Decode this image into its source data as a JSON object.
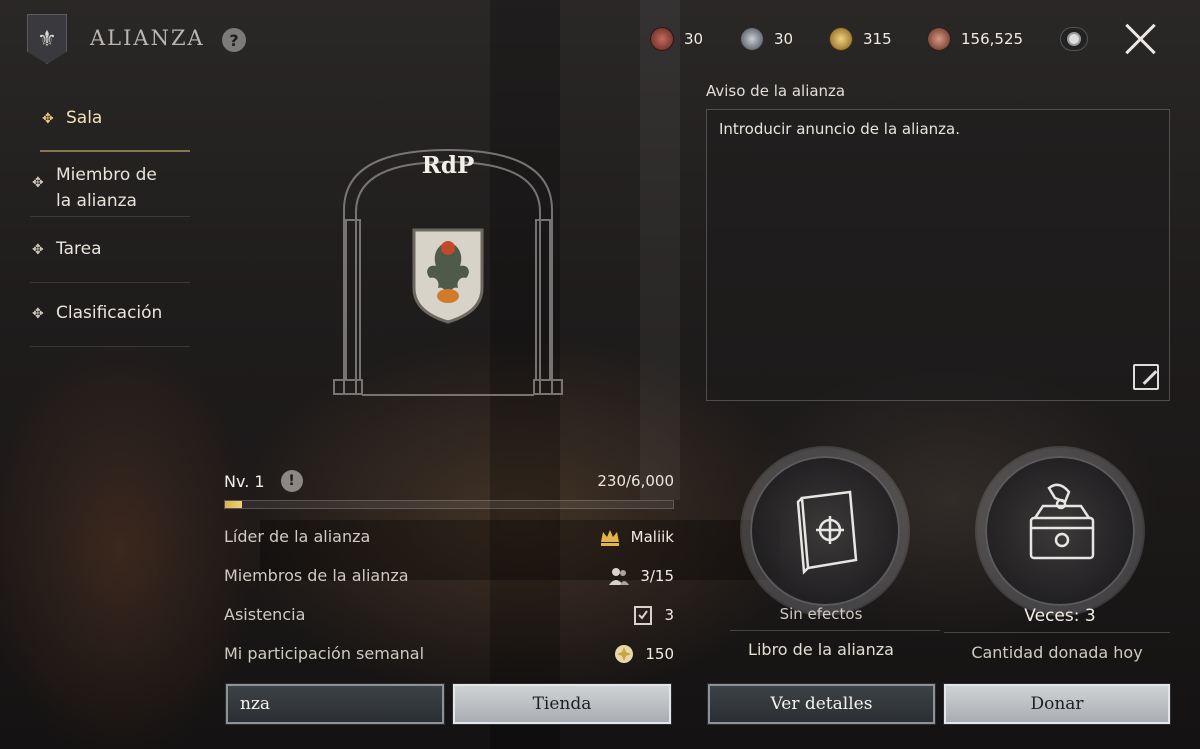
{
  "header": {
    "title": "ALIANZA",
    "help_label": "?",
    "resources": [
      {
        "icon": "red-gem-icon",
        "value": "30",
        "color": "#8a3d35"
      },
      {
        "icon": "silver-gem-icon",
        "value": "30",
        "color": "#6c7379"
      },
      {
        "icon": "gold-coin-icon",
        "value": "315",
        "color": "#b08a35"
      },
      {
        "icon": "copper-coin-icon",
        "value": "156,525",
        "color": "#8b4f3c"
      }
    ]
  },
  "sidebar": {
    "items": [
      {
        "label": "Sala",
        "active": true
      },
      {
        "label": "Miembro de\nla alianza",
        "active": false
      },
      {
        "label": "Tarea",
        "active": false
      },
      {
        "label": "Clasificación",
        "active": false
      }
    ]
  },
  "alliance": {
    "name": "RdP",
    "level": "Nv. 1",
    "warn_label": "!",
    "xp": "230/6,000",
    "xp_fraction": 0.038,
    "stats": [
      {
        "label": "Líder de la alianza",
        "value": "Maliik",
        "icon": "crown-icon"
      },
      {
        "label": "Miembros de la alianza",
        "value": "3/15",
        "icon": "members-icon"
      },
      {
        "label": "Asistencia",
        "value": "3",
        "icon": "checklist-icon"
      },
      {
        "label": "Mi participación semanal",
        "value": "150",
        "icon": "contribution-icon"
      }
    ]
  },
  "notice": {
    "title": "Aviso de la alianza",
    "text": "Introducir anuncio de la alianza."
  },
  "book": {
    "status": "Sin efectos",
    "label": "Libro de la alianza"
  },
  "donation": {
    "times": "Veces: 3",
    "label": "Cantidad donada hoy"
  },
  "buttons": {
    "left": "nza",
    "shop": "Tienda",
    "details": "Ver detalles",
    "donate": "Donar"
  },
  "accent_color": "#e9c97a"
}
